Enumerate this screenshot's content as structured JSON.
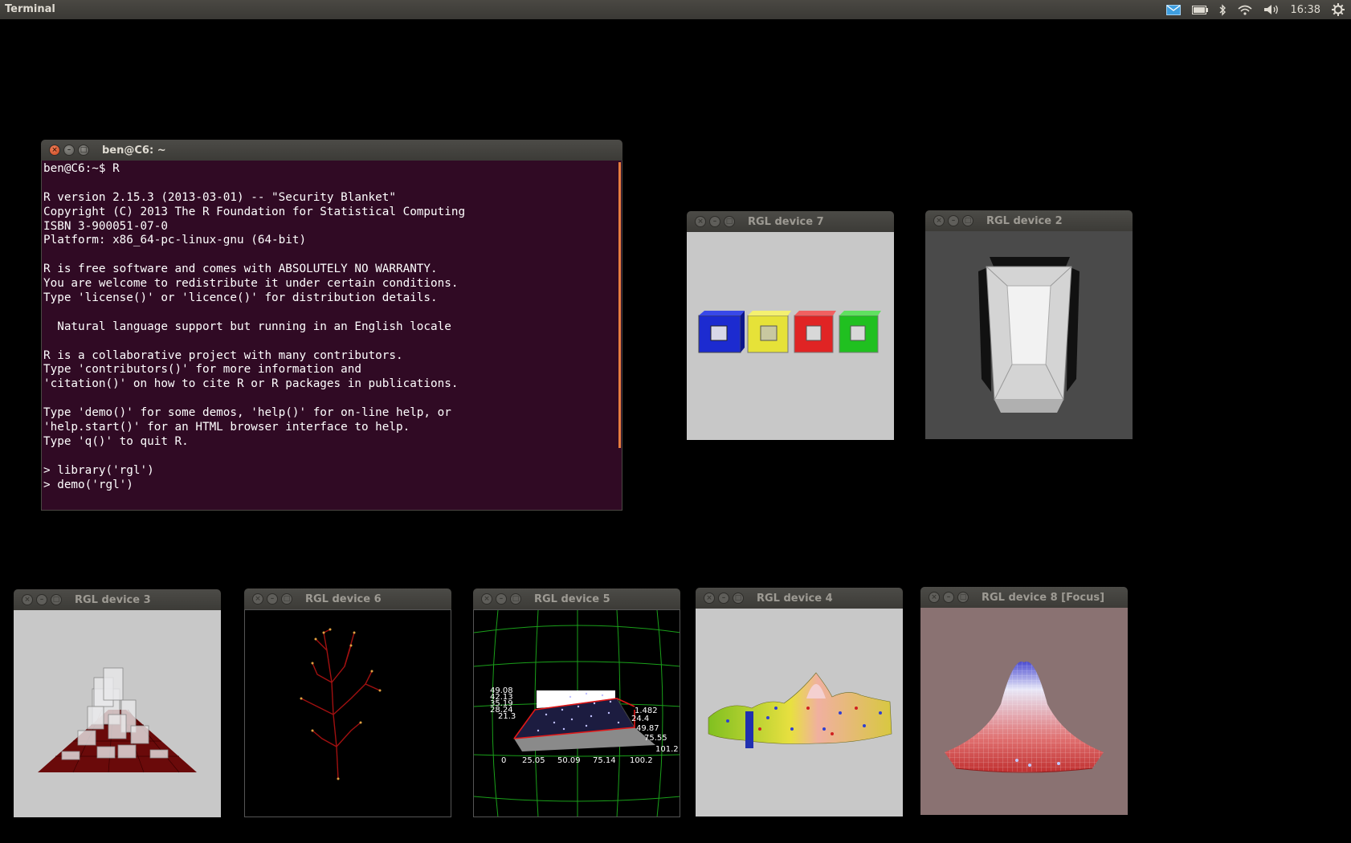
{
  "panel": {
    "app_title": "Terminal",
    "clock": "16:38",
    "icons": [
      "mail-icon",
      "battery-icon",
      "bluetooth-icon",
      "wifi-icon",
      "volume-icon",
      "gear-icon"
    ]
  },
  "terminal": {
    "title": "ben@C6: ~",
    "lines": [
      "ben@C6:~$ R",
      "",
      "R version 2.15.3 (2013-03-01) -- \"Security Blanket\"",
      "Copyright (C) 2013 The R Foundation for Statistical Computing",
      "ISBN 3-900051-07-0",
      "Platform: x86_64-pc-linux-gnu (64-bit)",
      "",
      "R is free software and comes with ABSOLUTELY NO WARRANTY.",
      "You are welcome to redistribute it under certain conditions.",
      "Type 'license()' or 'licence()' for distribution details.",
      "",
      "  Natural language support but running in an English locale",
      "",
      "R is a collaborative project with many contributors.",
      "Type 'contributors()' for more information and",
      "'citation()' on how to cite R or R packages in publications.",
      "",
      "Type 'demo()' for some demos, 'help()' for on-line help, or",
      "'help.start()' for an HTML browser interface to help.",
      "Type 'q()' to quit R.",
      "",
      "> library('rgl')",
      "> demo('rgl')"
    ]
  },
  "windows": {
    "dev7": {
      "title": "RGL device 7"
    },
    "dev2": {
      "title": "RGL device 2"
    },
    "dev3": {
      "title": "RGL device 3"
    },
    "dev6": {
      "title": "RGL device 6"
    },
    "dev5": {
      "title": "RGL device 5",
      "z_ticks": [
        "49.08",
        "42.13",
        "35.19",
        "28.24",
        "21.3"
      ],
      "x_ticks": [
        "0",
        "25.05",
        "50.09",
        "75.14",
        "100.2"
      ],
      "y_ticks": [
        "1.482",
        "24.4",
        "49.87",
        "75.55",
        "101.2"
      ]
    },
    "dev4": {
      "title": "RGL device 4"
    },
    "dev8": {
      "title": "RGL device 8 [Focus]"
    }
  },
  "colors": {
    "terminal_bg": "#300a24",
    "panel_bg": "#3c3b37",
    "accent_orange": "#e77d3f"
  }
}
